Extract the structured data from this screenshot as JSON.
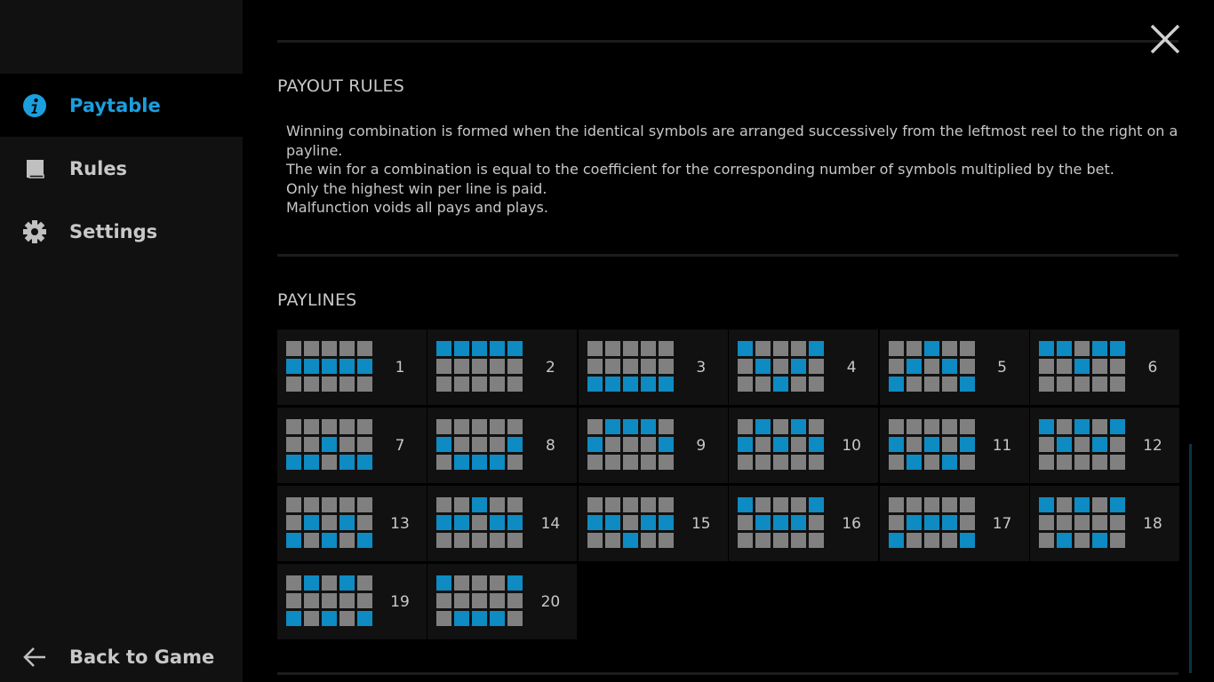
{
  "sidebar": {
    "items": [
      {
        "label": "Paytable",
        "icon": "info-icon",
        "active": true
      },
      {
        "label": "Rules",
        "icon": "book-icon",
        "active": false
      },
      {
        "label": "Settings",
        "icon": "gear-icon",
        "active": false
      }
    ],
    "back": {
      "label": "Back to Game",
      "icon": "arrow-left-icon"
    }
  },
  "header": {
    "close_icon": "close-icon"
  },
  "payout_rules": {
    "title": "PAYOUT RULES",
    "lines": [
      "Winning combination is formed when the identical symbols are arranged successively from the leftmost reel to the right on a payline.",
      "The win for a combination is equal to the coefficient for the corresponding number of symbols multiplied by the bet.",
      "Only the highest win per line is paid.",
      "Malfunction voids all pays and plays."
    ]
  },
  "paylines": {
    "title": "PAYLINES",
    "colors": {
      "active": "#0d8bc2",
      "inactive": "#808080"
    },
    "items": [
      {
        "number": "1",
        "rows": [
          1,
          1,
          1,
          1,
          1
        ]
      },
      {
        "number": "2",
        "rows": [
          0,
          0,
          0,
          0,
          0
        ]
      },
      {
        "number": "3",
        "rows": [
          2,
          2,
          2,
          2,
          2
        ]
      },
      {
        "number": "4",
        "rows": [
          0,
          1,
          2,
          1,
          0
        ]
      },
      {
        "number": "5",
        "rows": [
          2,
          1,
          0,
          1,
          2
        ]
      },
      {
        "number": "6",
        "rows": [
          0,
          0,
          1,
          0,
          0
        ]
      },
      {
        "number": "7",
        "rows": [
          2,
          2,
          1,
          2,
          2
        ]
      },
      {
        "number": "8",
        "rows": [
          1,
          2,
          2,
          2,
          1
        ]
      },
      {
        "number": "9",
        "rows": [
          1,
          0,
          0,
          0,
          1
        ]
      },
      {
        "number": "10",
        "rows": [
          1,
          0,
          1,
          0,
          1
        ]
      },
      {
        "number": "11",
        "rows": [
          1,
          2,
          1,
          2,
          1
        ]
      },
      {
        "number": "12",
        "rows": [
          0,
          1,
          0,
          1,
          0
        ]
      },
      {
        "number": "13",
        "rows": [
          2,
          1,
          2,
          1,
          2
        ]
      },
      {
        "number": "14",
        "rows": [
          1,
          1,
          0,
          1,
          1
        ]
      },
      {
        "number": "15",
        "rows": [
          1,
          1,
          2,
          1,
          1
        ]
      },
      {
        "number": "16",
        "rows": [
          0,
          1,
          1,
          1,
          0
        ]
      },
      {
        "number": "17",
        "rows": [
          2,
          1,
          1,
          1,
          2
        ]
      },
      {
        "number": "18",
        "rows": [
          0,
          2,
          0,
          2,
          0
        ]
      },
      {
        "number": "19",
        "rows": [
          2,
          0,
          2,
          0,
          2
        ]
      },
      {
        "number": "20",
        "rows": [
          0,
          2,
          2,
          2,
          0
        ]
      }
    ]
  },
  "theme": {
    "accent": "#1a9fdf",
    "sidebar_bg": "#111111",
    "content_bg": "#000000"
  }
}
